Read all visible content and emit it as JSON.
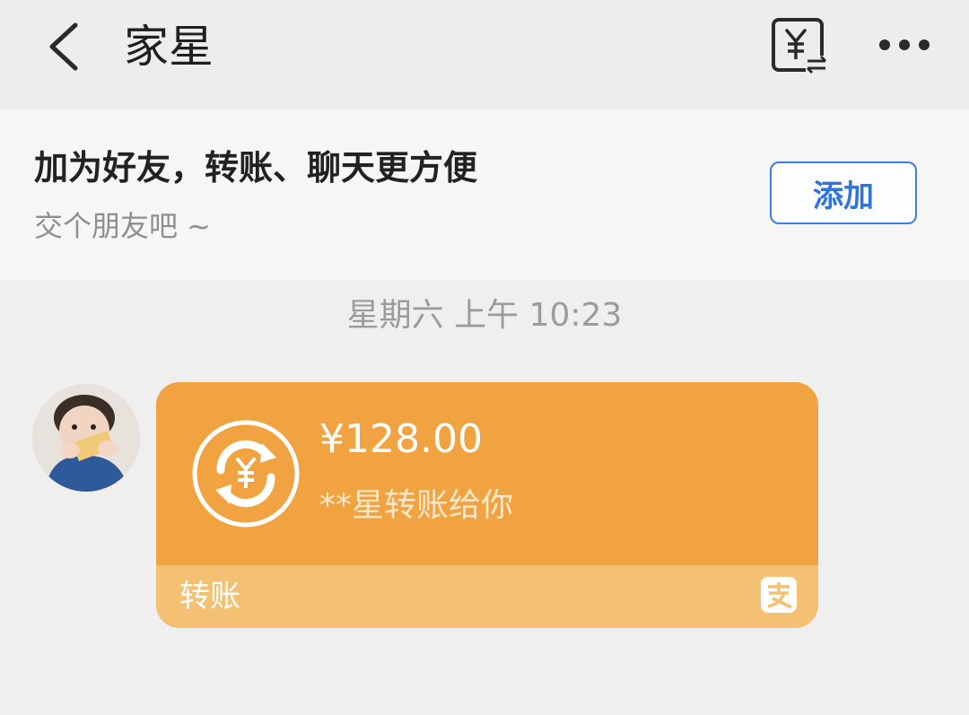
{
  "header": {
    "title": "家星",
    "icons": {
      "back": "chevron-left-icon",
      "transfer": "yuan-transfer-icon",
      "more": "more-dots-icon"
    }
  },
  "banner": {
    "title": "加为好友，转账、聊天更方便",
    "subtitle": "交个朋友吧 ~",
    "add_button_label": "添加"
  },
  "chat": {
    "timestamp": "星期六 上午 10:23",
    "message": {
      "amount": "¥128.00",
      "description": "**星转账给你",
      "type_label": "转账",
      "icons": {
        "card": "yuan-circle-icon",
        "brand": "alipay-icon"
      }
    }
  },
  "colors": {
    "card_top": "#f0a340",
    "card_bottom": "#f4c172",
    "accent_blue": "#2f74dc",
    "page_bg": "#efefef"
  }
}
